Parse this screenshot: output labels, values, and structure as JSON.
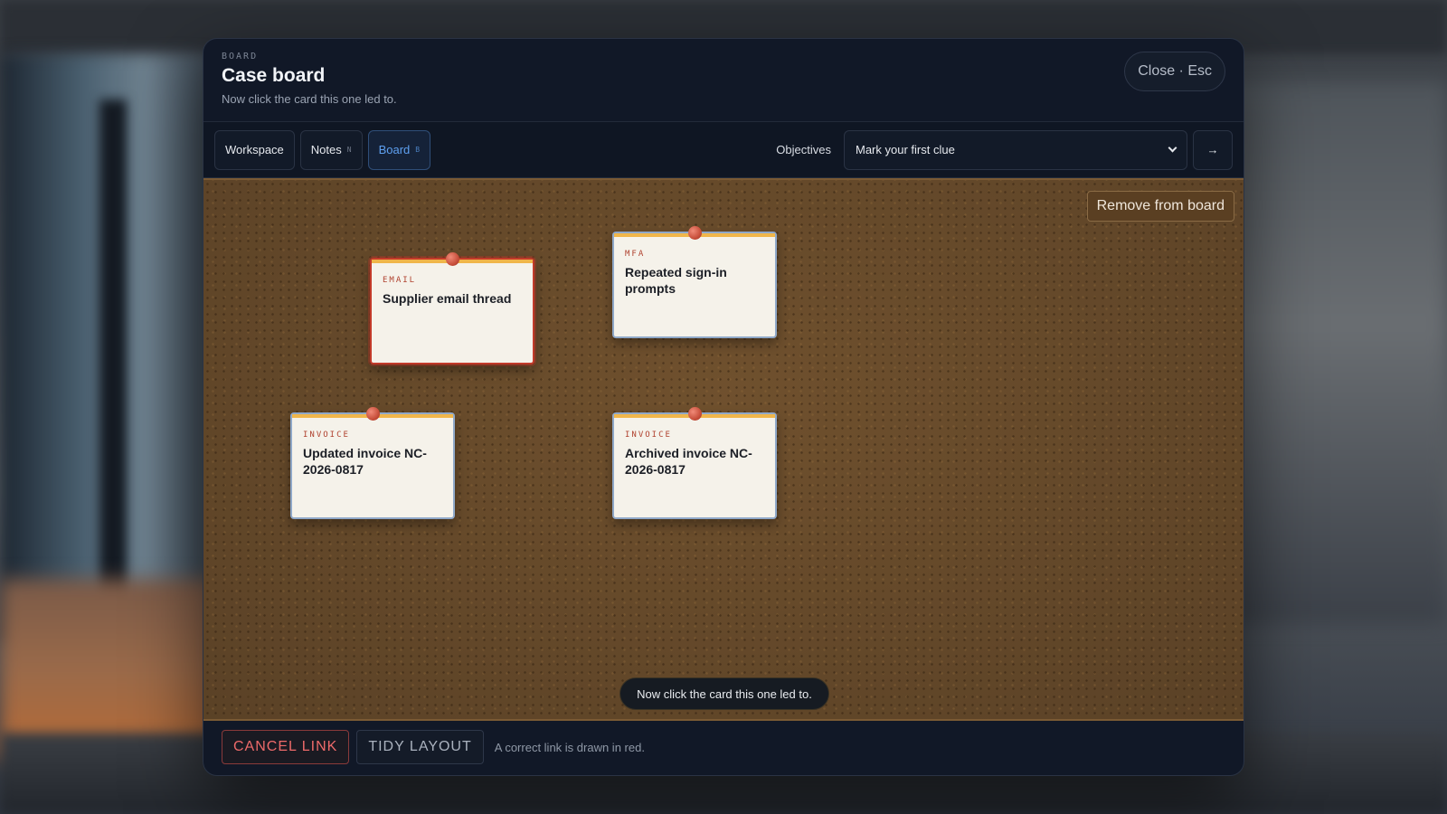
{
  "modal": {
    "eyebrow": "BOARD",
    "title": "Case board",
    "subtitle": "Now click the card this one led to.",
    "close_label": "Close · Esc"
  },
  "toolbar": {
    "tabs": [
      {
        "label": "Workspace",
        "shortcut": ""
      },
      {
        "label": "Notes",
        "shortcut": "N"
      },
      {
        "label": "Board",
        "shortcut": "B",
        "active": true
      }
    ],
    "objectives_label": "Objectives",
    "objectives_selected": "Mark your first clue",
    "go_label": "→"
  },
  "board": {
    "remove_label": "Remove from board",
    "cards": [
      {
        "tag": "EMAIL",
        "title": "Supplier email thread",
        "selected": true
      },
      {
        "tag": "MFA",
        "title": "Repeated sign-in prompts",
        "selected": false
      },
      {
        "tag": "INVOICE",
        "title": "Updated invoice NC-2026-0817",
        "selected": false
      },
      {
        "tag": "INVOICE",
        "title": "Archived invoice NC-2026-0817",
        "selected": false
      }
    ],
    "toast": "Now click the card this one led to."
  },
  "footer": {
    "cancel_label": "CANCEL LINK",
    "tidy_label": "TIDY LAYOUT",
    "hint": "A correct link is drawn in red."
  },
  "colors": {
    "accent": "#5ea0f0",
    "selected_border": "#c23a2a",
    "board": "#6b4e2e"
  }
}
